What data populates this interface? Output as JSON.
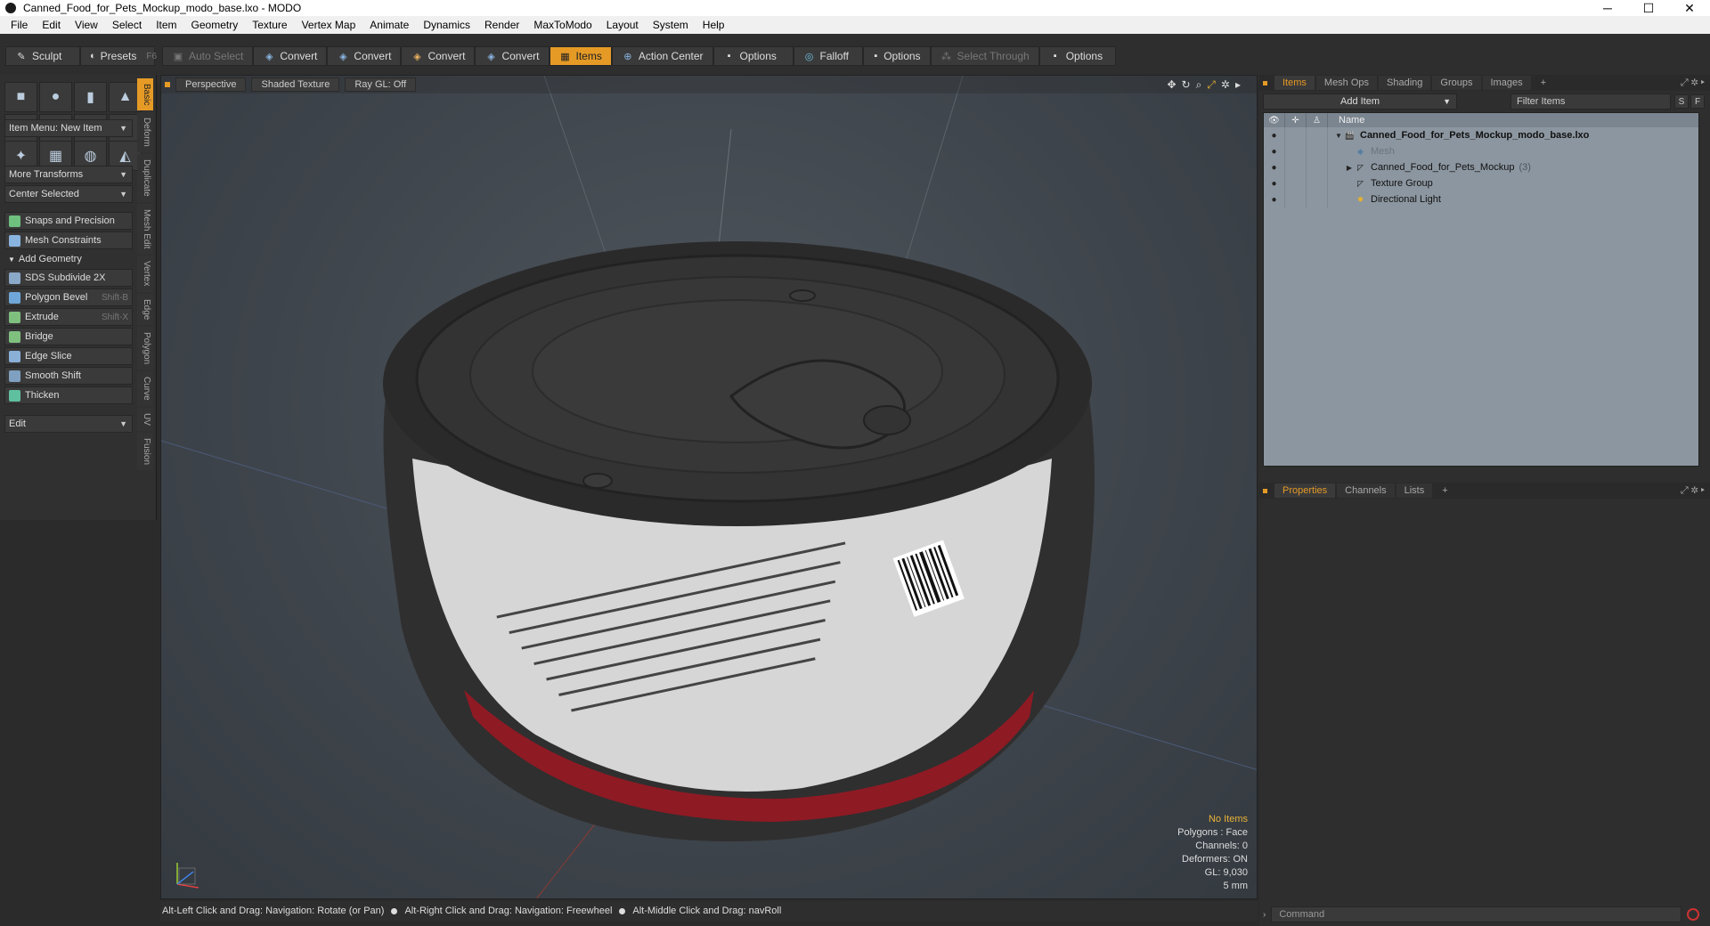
{
  "window": {
    "title": "Canned_Food_for_Pets_Mockup_modo_base.lxo - MODO",
    "minimize": "─",
    "maximize": "☐",
    "close": "✕"
  },
  "menu": [
    "File",
    "Edit",
    "View",
    "Select",
    "Item",
    "Geometry",
    "Texture",
    "Vertex Map",
    "Animate",
    "Dynamics",
    "Render",
    "MaxToModo",
    "Layout",
    "System",
    "Help"
  ],
  "toolbar": {
    "sculpt": "Sculpt",
    "presets": "Presets",
    "presets_key": "F6",
    "auto_select": "Auto Select",
    "convert1": "Convert",
    "convert2": "Convert",
    "convert3": "Convert",
    "convert4": "Convert",
    "items": "Items",
    "action_center": "Action Center",
    "options1": "Options",
    "falloff": "Falloff",
    "options2": "Options",
    "select_through": "Select Through",
    "options3": "Options"
  },
  "left": {
    "item_menu": "Item Menu: New Item",
    "more_transforms": "More Transforms",
    "center_selected": "Center Selected",
    "snaps": "Snaps and Precision",
    "mesh_constraints": "Mesh Constraints",
    "add_geometry": "Add Geometry",
    "tools": [
      {
        "label": "SDS Subdivide 2X",
        "shortcut": "",
        "color": "#8aa8c8"
      },
      {
        "label": "Polygon Bevel",
        "shortcut": "Shift-B",
        "color": "#6fa8d8"
      },
      {
        "label": "Extrude",
        "shortcut": "Shift-X",
        "color": "#7fc07f"
      },
      {
        "label": "Bridge",
        "shortcut": "",
        "color": "#7fc07f"
      },
      {
        "label": "Edge Slice",
        "shortcut": "",
        "color": "#8ab0d8"
      },
      {
        "label": "Smooth Shift",
        "shortcut": "",
        "color": "#7fa0c0"
      },
      {
        "label": "Thicken",
        "shortcut": "",
        "color": "#5fc0a0"
      }
    ],
    "edit_dropdown": "Edit",
    "vtabs": [
      "Basic",
      "Deform",
      "Duplicate",
      "Mesh Edit",
      "Vertex",
      "Edge",
      "Polygon",
      "Curve",
      "UV",
      "Fusion"
    ]
  },
  "viewport": {
    "view": "Perspective",
    "shading": "Shaded Texture",
    "raygl": "Ray GL: Off",
    "stats": {
      "selection": "No Items",
      "polygons": "Polygons : Face",
      "channels": "Channels: 0",
      "deformers": "Deformers: ON",
      "gl": "GL: 9,030",
      "grid": "5 mm"
    }
  },
  "status": {
    "hint1": "Alt-Left Click and Drag: Navigation: Rotate (or Pan)",
    "hint2": "Alt-Right Click and Drag: Navigation: Freewheel",
    "hint3": "Alt-Middle Click and Drag: navRoll"
  },
  "right": {
    "tabs": [
      "Items",
      "Mesh Ops",
      "Shading",
      "Groups",
      "Images"
    ],
    "add_item": "Add Item",
    "filter_placeholder": "Filter Items",
    "btn_s": "S",
    "btn_f": "F",
    "name_header": "Name",
    "tree": [
      {
        "label": "Canned_Food_for_Pets_Mockup_modo_base.lxo",
        "count": "",
        "level": 0
      },
      {
        "label": "Mesh",
        "count": "",
        "level": 1
      },
      {
        "label": "Canned_Food_for_Pets_Mockup",
        "count": "(3)",
        "level": 1
      },
      {
        "label": "Texture Group",
        "count": "",
        "level": 1
      },
      {
        "label": "Directional Light",
        "count": "",
        "level": 1
      }
    ],
    "prop_tabs": [
      "Properties",
      "Channels",
      "Lists"
    ],
    "command_placeholder": "Command"
  },
  "colors": {
    "accent": "#e59a26",
    "tree_bg": "#8c96a0",
    "can_label": "#d8d8d8",
    "can_metal": "#2e2e2e",
    "can_red": "#8e1a24"
  }
}
